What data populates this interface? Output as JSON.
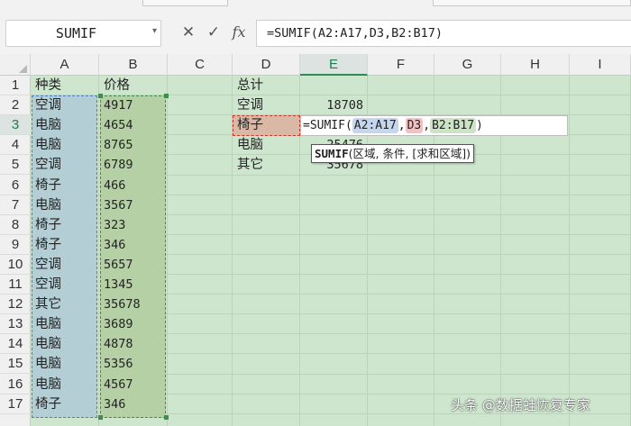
{
  "formula_bar": {
    "name_box": "SUMIF",
    "formula": "=SUMIF(A2:A17,D3,B2:B17)",
    "cancel_icon": "close-icon",
    "confirm_icon": "check-icon",
    "function_icon": "fx-icon"
  },
  "columns": [
    "A",
    "B",
    "C",
    "D",
    "E",
    "F",
    "G",
    "H",
    "I"
  ],
  "active_column": "E",
  "rows": [
    "1",
    "2",
    "3",
    "4",
    "5",
    "6",
    "7",
    "8",
    "9",
    "10",
    "11",
    "12",
    "13",
    "14",
    "15",
    "16",
    "17"
  ],
  "active_row": "3",
  "sheet": {
    "A": [
      "种类",
      "空调",
      "电脑",
      "电脑",
      "空调",
      "椅子",
      "电脑",
      "椅子",
      "椅子",
      "空调",
      "空调",
      "其它",
      "电脑",
      "电脑",
      "电脑",
      "电脑",
      "椅子"
    ],
    "B": [
      "价格",
      "4917",
      "4654",
      "8765",
      "6789",
      "466",
      "3567",
      "323",
      "346",
      "5657",
      "1345",
      "35678",
      "3689",
      "4878",
      "5356",
      "4567",
      "346"
    ],
    "D": [
      "总计",
      "空调",
      "椅子",
      "电脑",
      "其它"
    ],
    "E": [
      "",
      "18708",
      "",
      "25476",
      "35678"
    ]
  },
  "editing": {
    "prefix": "=SUMIF(",
    "arg1": "A2:A17",
    "sep1": ",",
    "arg2": "D3",
    "sep2": ",",
    "arg3": "B2:B17",
    "suffix": ")"
  },
  "tooltip": {
    "fn": "SUMIF",
    "args": "(区域, 条件, [求和区域])"
  },
  "watermark": "头条 @数据蛙恢复专家",
  "colors": {
    "grid_background": "#cde6cd",
    "range_a": "#b3cfd5",
    "range_b": "#b6d0a6",
    "criteria_cell": "#d9b8a6",
    "active_header": "#1d7d4a"
  }
}
